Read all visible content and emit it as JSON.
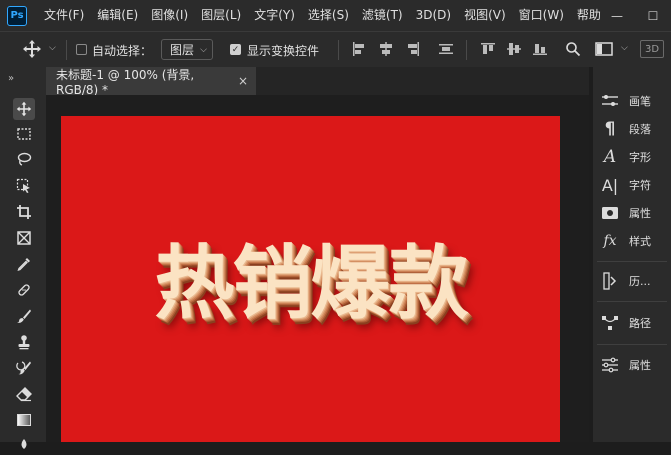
{
  "app": {
    "logo_text": "Ps"
  },
  "menu": [
    "文件(F)",
    "编辑(E)",
    "图像(I)",
    "图层(L)",
    "文字(Y)",
    "选择(S)",
    "滤镜(T)",
    "3D(D)",
    "视图(V)",
    "窗口(W)",
    "帮助"
  ],
  "window_controls": {
    "minimize": "—",
    "maximize": "☐"
  },
  "options_bar": {
    "auto_select_label": "自动选择：",
    "auto_select_checked": false,
    "auto_select_target": "图层",
    "show_transform_label": "显示变换控件",
    "show_transform_checked": true,
    "badge_3d": "3D"
  },
  "document_tab": {
    "title": "未标题-1 @ 100% (背景, RGB/8) *",
    "close": "×"
  },
  "canvas": {
    "headline": "热销爆款",
    "background_color": "#db1818"
  },
  "right_panel": {
    "items": [
      {
        "label": "画笔",
        "icon": "brush-settings-icon"
      },
      {
        "label": "段落",
        "icon": "paragraph-icon"
      },
      {
        "label": "字形",
        "icon": "glyphs-icon"
      },
      {
        "label": "字符",
        "icon": "character-icon"
      },
      {
        "label": "属性",
        "icon": "properties-icon"
      },
      {
        "label": "样式",
        "icon": "styles-icon"
      },
      {
        "label": "历...",
        "icon": "history-icon"
      },
      {
        "label": "路径",
        "icon": "paths-icon"
      },
      {
        "label": "属性",
        "icon": "adjustments-icon"
      }
    ]
  },
  "colors": {
    "chrome": "#2b2b2b",
    "accent": "#31a8ff"
  }
}
